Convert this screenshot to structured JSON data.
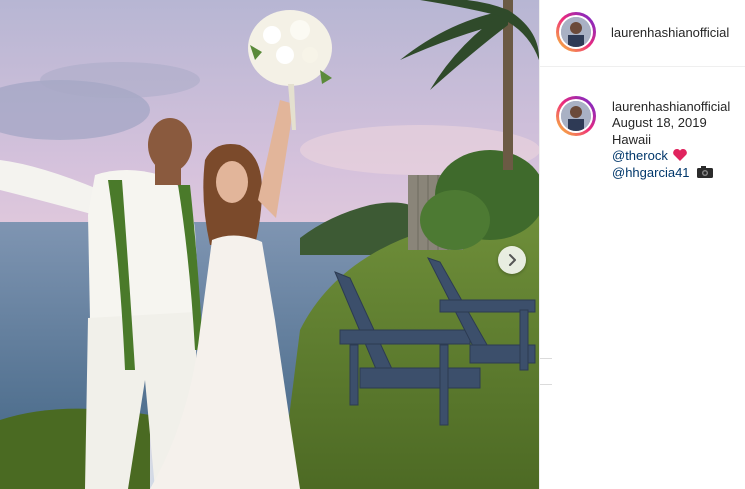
{
  "post": {
    "username": "laurenhashianofficial",
    "caption": {
      "date_line": "August 18, 2019",
      "location_line": "Hawaii",
      "mention_1": "@therock",
      "mention_1_emoji": "red-heart",
      "mention_2": "@hhgarcia41",
      "mention_2_emoji": "camera"
    }
  },
  "carousel": {
    "next_icon": "chevron-right-icon"
  }
}
